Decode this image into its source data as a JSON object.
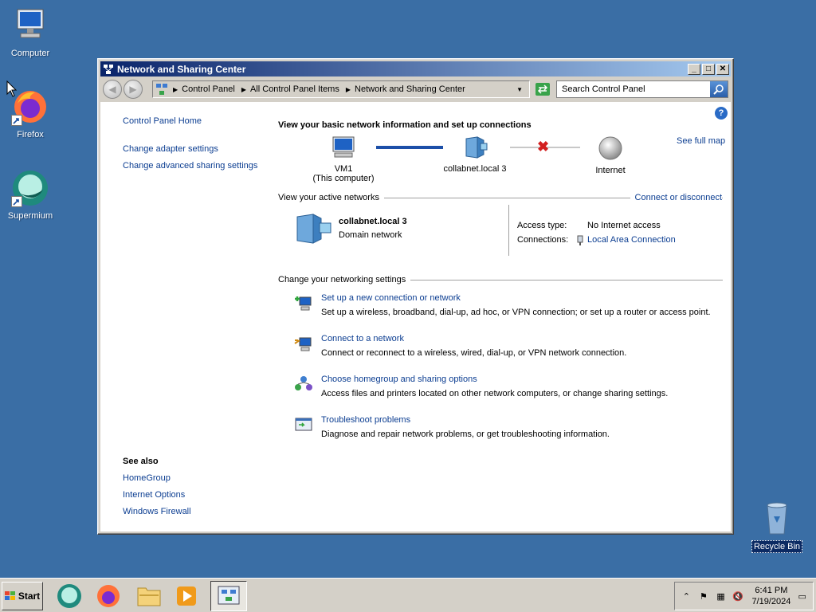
{
  "desktop": {
    "icons": [
      {
        "label": "Computer"
      },
      {
        "label": "Firefox"
      },
      {
        "label": "Supermium"
      },
      {
        "label": "Recycle Bin"
      }
    ]
  },
  "window": {
    "title": "Network and Sharing Center",
    "address": {
      "crumbs": [
        "Control Panel",
        "All Control Panel Items",
        "Network and Sharing Center"
      ]
    },
    "search_placeholder": "Search Control Panel"
  },
  "left_pane": {
    "home": "Control Panel Home",
    "links": [
      "Change adapter settings",
      "Change advanced sharing settings"
    ],
    "see_also_title": "See also",
    "see_also": [
      "HomeGroup",
      "Internet Options",
      "Windows Firewall"
    ]
  },
  "main": {
    "heading": "View your basic network information and set up connections",
    "see_full_map": "See full map",
    "map": {
      "computer_name": "VM1",
      "computer_sub": "(This computer)",
      "network": "collabnet.local  3",
      "internet": "Internet"
    },
    "active_networks_label": "View your active networks",
    "connect_disconnect": "Connect or disconnect",
    "active_network": {
      "name": "collabnet.local  3",
      "type": "Domain network",
      "access_type_label": "Access type:",
      "access_type_value": "No Internet access",
      "connections_label": "Connections:",
      "connections_value": "Local Area Connection"
    },
    "change_settings_label": "Change your networking settings",
    "tasks": [
      {
        "title": "Set up a new connection or network",
        "desc": "Set up a wireless, broadband, dial-up, ad hoc, or VPN connection; or set up a router or access point."
      },
      {
        "title": "Connect to a network",
        "desc": "Connect or reconnect to a wireless, wired, dial-up, or VPN network connection."
      },
      {
        "title": "Choose homegroup and sharing options",
        "desc": "Access files and printers located on other network computers, or change sharing settings."
      },
      {
        "title": "Troubleshoot problems",
        "desc": "Diagnose and repair network problems, or get troubleshooting information."
      }
    ]
  },
  "taskbar": {
    "start_label": "Start",
    "clock_time": "6:41 PM",
    "clock_date": "7/19/2024"
  },
  "colors": {
    "desktop": "#3a6ea5",
    "link": "#0b3d91",
    "title_start": "#0a246a",
    "title_end": "#a6caf0"
  }
}
